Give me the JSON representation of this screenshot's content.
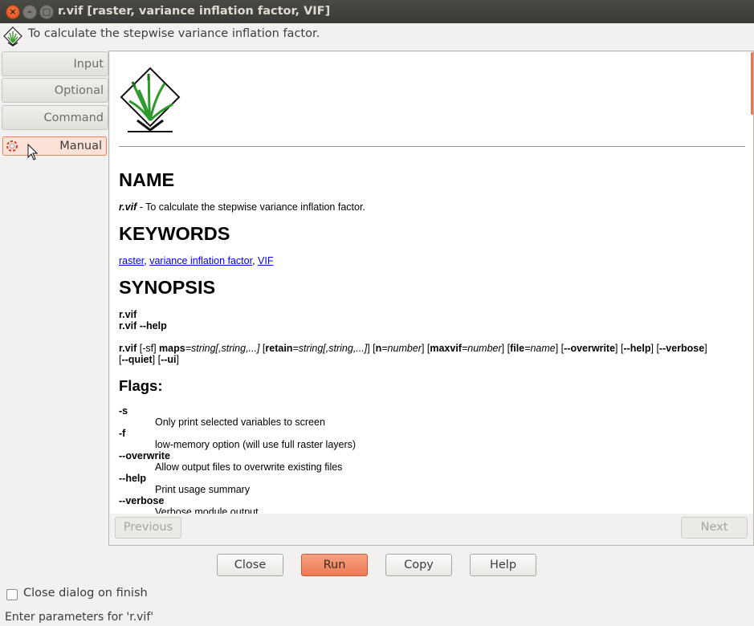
{
  "window": {
    "title": "r.vif [raster, variance inflation factor, VIF]",
    "close_glyph": "×",
    "min_glyph": "–",
    "max_glyph": "□"
  },
  "header": {
    "description": "To calculate the stepwise variance inflation factor.",
    "icon": "grass-logo-icon"
  },
  "tabs": [
    {
      "label": "Input"
    },
    {
      "label": "Optional"
    },
    {
      "label": "Command output"
    },
    {
      "label": "Manual",
      "active": true,
      "icon": "lifebuoy-icon"
    }
  ],
  "manual": {
    "name_heading": "NAME",
    "name_cmd": "r.vif",
    "name_desc": " - To calculate the stepwise variance inflation factor.",
    "keywords_heading": "KEYWORDS",
    "keywords": [
      "raster",
      "variance inflation factor",
      "VIF"
    ],
    "synopsis_heading": "SYNOPSIS",
    "synopsis_line1": "r.vif",
    "synopsis_line2": "r.vif --help",
    "usage": {
      "cmd": "r.vif",
      "flags_part": " [-sf] ",
      "maps_kw": "maps",
      "maps_val": "=string[,string,...]",
      "retain_kw": "retain",
      "retain_val": "=string[,string,...]",
      "n_kw": "n",
      "n_val": "=number",
      "maxvif_kw": "maxvif",
      "maxvif_val": "=number",
      "file_kw": "file",
      "file_val": "=name",
      "overwrite": "--overwrite",
      "help": "--help",
      "verbose": "--verbose",
      "quiet": "--quiet",
      "ui": "--ui"
    },
    "flags_heading": "Flags:",
    "flags": [
      {
        "flag": "-s",
        "desc": "Only print selected variables to screen"
      },
      {
        "flag": "-f",
        "desc": "low-memory option (will use full raster layers)"
      },
      {
        "flag": "--overwrite",
        "desc": "Allow output files to overwrite existing files"
      },
      {
        "flag": "--help",
        "desc": "Print usage summary"
      },
      {
        "flag": "--verbose",
        "desc": "Verbose module output"
      }
    ]
  },
  "nav": {
    "previous": "Previous",
    "next": "Next"
  },
  "buttons": {
    "close": "Close",
    "run": "Run",
    "copy": "Copy",
    "help": "Help"
  },
  "close_on_finish": {
    "label": "Close dialog on finish",
    "checked": false
  },
  "status": "Enter parameters for 'r.vif'",
  "colors": {
    "accent": "#ee7a54",
    "active_tab_bg": "#fbe1d6",
    "link": "#0000ee"
  }
}
